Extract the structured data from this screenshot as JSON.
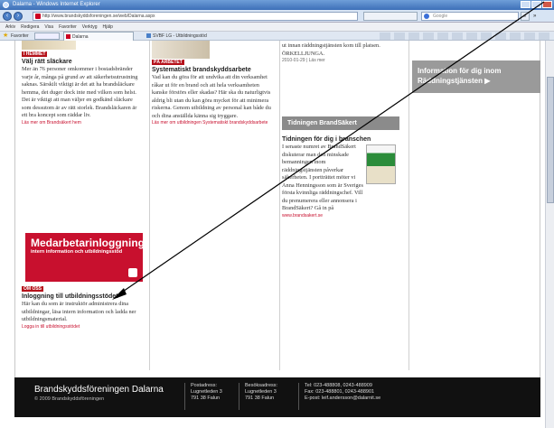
{
  "browser": {
    "window_title": "Dalarna - Windows Internet Explorer",
    "address": "http://www.brandskyddsforeningen.se/web/Dalarna.aspx",
    "search_placeholder": "Google",
    "menu": [
      "Arkiv",
      "Redigera",
      "Visa",
      "Favoriter",
      "Verktyg",
      "Hjälp"
    ],
    "favorites_label": "Favoriter",
    "tabs": [
      "Dalarna",
      "SVBF LG - Utbildningsstöd"
    ]
  },
  "col1": {
    "badge": "I HEMMET",
    "heading": "Välj rätt släckare",
    "body": "Mer än 76 personer omkommer i bostadsbränder varje år, många på grund av att säkerhetsutrustning saknas. Särskilt viktigt är det att ha brandsläckare hemma, det duger dock inte med vilken som helst. Det är viktigt att man väljer en godkänd släckare som dessutom är av rätt storlek. Brandsläckaren är ett bra koncept som räddar liv.",
    "link": "Läs mer om Brandsäkert hem"
  },
  "col2": {
    "badge": "PÅ ARBETET",
    "heading": "Systematiskt brandskyddsarbete",
    "body": "Vad kan du göra för att undvika att din verksamhet råkar ut för en brand och att hela verksamheten kanske förstörs eller skadas? Här ska du naturligtvis aldrig bli utan du kan göra mycket för att minimera riskerna. Genom utbildning av personal kan både du och dina anställda känna sig tryggare.",
    "link": "Läs mer om utbildningen Systematiskt brandskyddsarbete"
  },
  "col3": {
    "top_text": "ut innan räddningstjänsten kom till platsen. ÖRKELLJUNGA.",
    "top_date": "2010-01-29 | Läs mer",
    "section_tab": "Tidningen BrandSäkert",
    "heading": "Tidningen för dig i branschen",
    "body": "I senaste numret av BrandSäkert diskuterar man den minskade bemanningen inom räddningstjänsten påverkar säkerheten. I portträttet möter vi Anna Henningsson som är Sveriges första kvinnliga räddningschef. Vill du prenumerera eller annonsera i BrandSäkert? Gå in på",
    "link": "www.brandsakert.se"
  },
  "col4": {
    "banner": "Information för dig inom Räddningstjänsten ▶"
  },
  "login_box": {
    "banner_title": "Medarbetarinloggning",
    "banner_sub": "intern information och utbildningsstöd",
    "badge": "OM OSS",
    "heading": "Inloggning till utbildningsstödet",
    "body": "Här kan du som är instruktör administrera dina utbildningar, läsa intern information och ladda ner utbildningsmaterial.",
    "link": "Logga in till utbildningsstödet"
  },
  "footer": {
    "brand": "Brandskyddsföreningen Dalarna",
    "copyright": "© 2009 Brandskyddsföreningen",
    "postal_label": "Postadress:",
    "postal_lines": [
      "Lugnetleden 3",
      "791 38 Falun"
    ],
    "visit_label": "Besöksadress:",
    "visit_lines": [
      "Lugnetleden 3",
      "791 38 Falun"
    ],
    "tel": "Tel: 023-488808, 0243-488909",
    "fax": "Fax: 023-488801, 0243-488901",
    "email": "E-post: leif.andersson@dalarnit.se"
  },
  "colors": {
    "brand_red": "#b5121b",
    "link_red": "#c8102e",
    "footer_bg": "#111111",
    "gray_banner": "#9a9a9a"
  }
}
